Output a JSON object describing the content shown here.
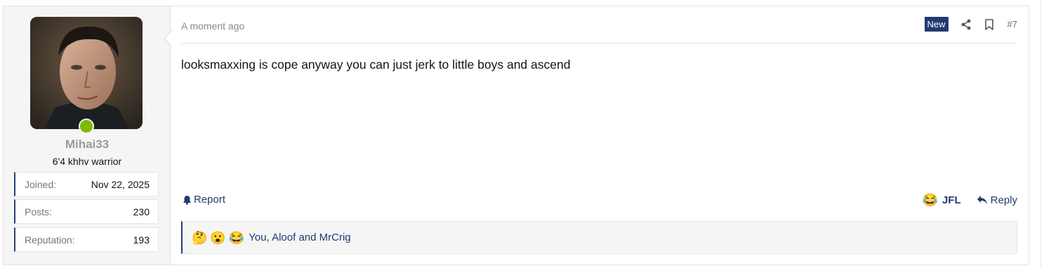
{
  "post": {
    "user": {
      "username": "Mihai33",
      "title": "6'4 khhv warrior",
      "online_color": "#7fb800",
      "stats": [
        {
          "label": "Joined:",
          "value": "Nov 22, 2025"
        },
        {
          "label": "Posts:",
          "value": "230"
        },
        {
          "label": "Reputation:",
          "value": "193"
        }
      ]
    },
    "timestamp": "A moment ago",
    "badge": "New",
    "post_number": "#7",
    "message": "looksmaxxing is cope anyway you can just jerk to little boys and ascend",
    "actions": {
      "report": "Report",
      "reaction_label": "JFL",
      "reaction_emoji": "😂",
      "reply": "Reply"
    },
    "reactions": {
      "emojis": [
        "🤔",
        "😮",
        "😂"
      ],
      "summary": "You, Aloof and MrCrig"
    },
    "colors": {
      "accent": "#223a70",
      "badge_bg": "#223a70",
      "user_panel_bg": "#f5f5f5"
    }
  }
}
